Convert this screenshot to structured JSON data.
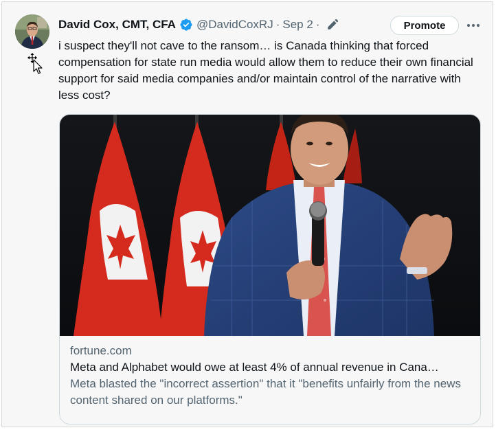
{
  "author": {
    "name": "David Cox, CMT, CFA",
    "handle": "@DavidCoxRJ",
    "separator": "·",
    "date": "Sep 2",
    "verified_color": "#1d9bf0",
    "avatar_icon": "profile-photo"
  },
  "actions": {
    "promote_label": "Promote",
    "more_icon": "ellipsis-icon",
    "edit_icon": "pencil-icon"
  },
  "tweet": {
    "text": "i suspect they'll not cave to the ransom… is Canada thinking that forced compensation for state run media would allow them to reduce their own financial support for said media companies and/or maintain control of the narrative with less cost?"
  },
  "card": {
    "image_subject": "speaker-with-microphone-before-canadian-flags",
    "domain": "fortune.com",
    "title": "Meta and Alphabet would owe at least 4% of annual revenue in Cana…",
    "description": "Meta blasted the \"incorrect assertion\" that it \"benefits unfairly from the news content shared on our platforms.\""
  },
  "colors": {
    "text_primary": "#0f1419",
    "text_secondary": "#536471",
    "border": "#cfd9de",
    "flag_red": "#d52b1e"
  }
}
